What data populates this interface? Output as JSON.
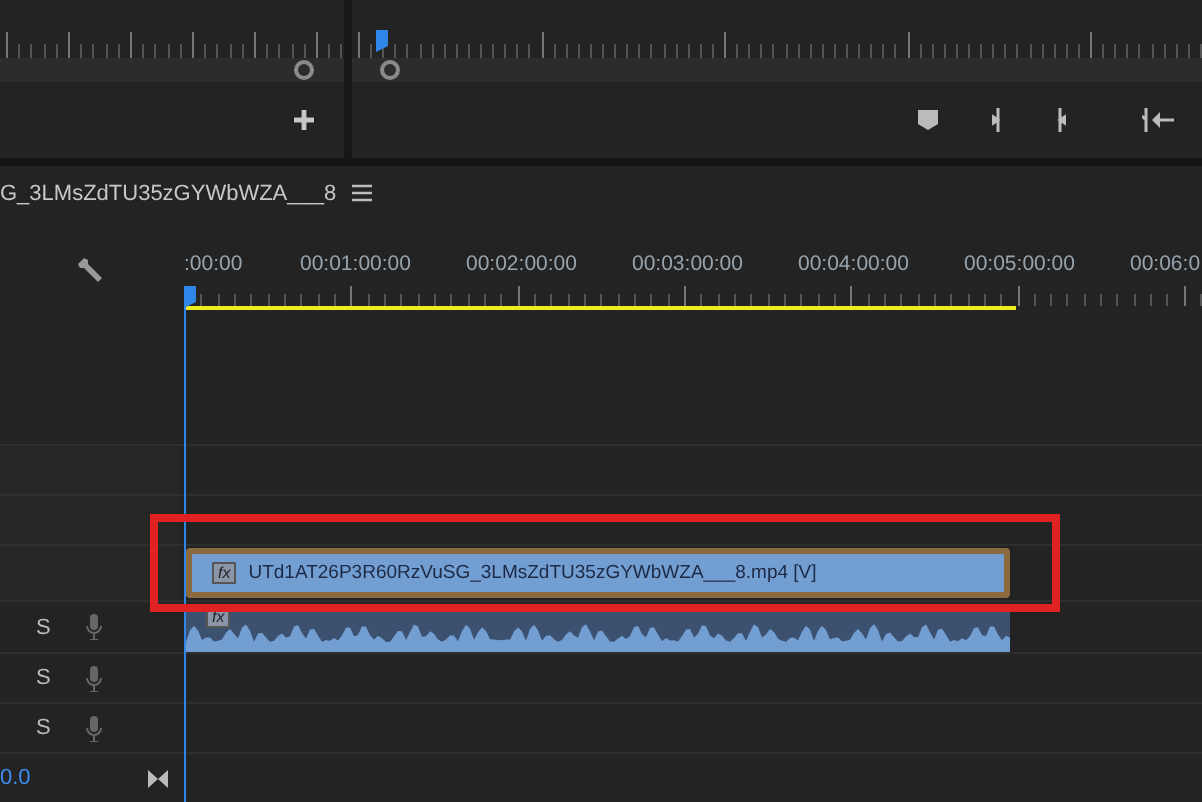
{
  "timeline": {
    "title": "G_3LMsZdTU35zGYWbWZA___8",
    "timecodes": [
      ":00:00",
      "00:01:00:00",
      "00:02:00:00",
      "00:03:00:00",
      "00:04:00:00",
      "00:05:00:00",
      "00:06:0"
    ],
    "tracks": [
      {
        "kind": "video"
      },
      {
        "kind": "video"
      },
      {
        "kind": "video",
        "clip": {
          "fx": "fx",
          "label": "UTd1AT26P3R60RzVuSG_3LMsZdTU35zGYWbWZA___8.mp4 [V]"
        }
      },
      {
        "kind": "audio",
        "solo": "S",
        "clip": {
          "fx": "fx"
        }
      },
      {
        "kind": "audio",
        "solo": "S"
      },
      {
        "kind": "audio",
        "solo": "S"
      },
      {
        "kind": "master",
        "value": "0.0"
      }
    ]
  }
}
